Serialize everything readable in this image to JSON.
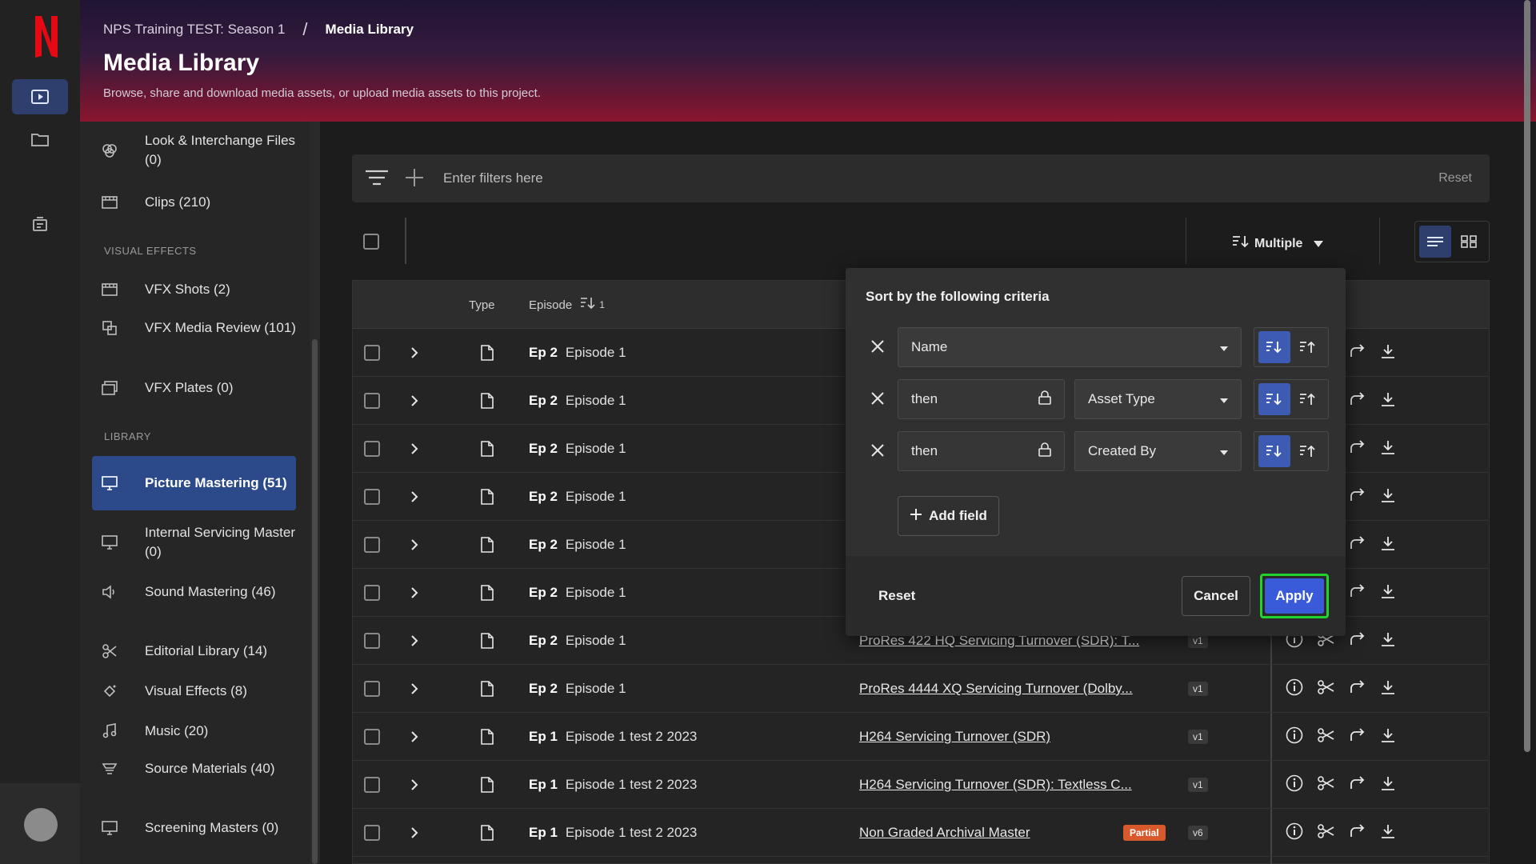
{
  "breadcrumb": {
    "project": "NPS Training TEST: Season 1",
    "separator": "/",
    "current": "Media Library"
  },
  "page": {
    "title": "Media Library",
    "subtitle": "Browse, share and download media assets, or upload media assets to this project."
  },
  "sidebar": {
    "items_top": [
      {
        "label": "Look & Interchange Files (0)",
        "icon": "circles-icon"
      },
      {
        "label": "Clips (210)",
        "icon": "film-icon"
      }
    ],
    "section_vfx": "VISUAL EFFECTS",
    "items_vfx": [
      {
        "label": "VFX Shots (2)",
        "icon": "film-icon"
      },
      {
        "label": "VFX Media Review (101)",
        "icon": "review-icon"
      },
      {
        "label": "VFX Plates (0)",
        "icon": "plates-icon"
      }
    ],
    "section_library": "LIBRARY",
    "items_library": [
      {
        "label": "Picture Mastering (51)",
        "icon": "monitor-icon",
        "active": true
      },
      {
        "label": "Internal Servicing Master (0)",
        "icon": "monitor-icon"
      },
      {
        "label": "Sound Mastering (46)",
        "icon": "speaker-icon"
      },
      {
        "label": "Editorial Library (14)",
        "icon": "scissors-icon"
      },
      {
        "label": "Visual Effects (8)",
        "icon": "sparkle-icon"
      },
      {
        "label": "Music (20)",
        "icon": "music-icon"
      },
      {
        "label": "Source Materials (40)",
        "icon": "source-icon"
      },
      {
        "label": "Screening Masters (0)",
        "icon": "monitor-icon"
      }
    ]
  },
  "filter": {
    "placeholder": "Enter filters here",
    "reset": "Reset"
  },
  "toolbar": {
    "sort_label": "Multiple"
  },
  "table": {
    "headers": {
      "type": "Type",
      "episode": "Episode",
      "episode_sort_rank": "1"
    },
    "rows": [
      {
        "ep": "Ep 2",
        "name": "Episode 1",
        "asset": "",
        "version": "",
        "partial": ""
      },
      {
        "ep": "Ep 2",
        "name": "Episode 1",
        "asset": "",
        "version": "",
        "partial": ""
      },
      {
        "ep": "Ep 2",
        "name": "Episode 1",
        "asset": "",
        "version": "",
        "partial": ""
      },
      {
        "ep": "Ep 2",
        "name": "Episode 1",
        "asset": "",
        "version": "",
        "partial": ""
      },
      {
        "ep": "Ep 2",
        "name": "Episode 1",
        "asset": "",
        "version": "",
        "partial": ""
      },
      {
        "ep": "Ep 2",
        "name": "Episode 1",
        "asset": "",
        "version": "",
        "partial": ""
      },
      {
        "ep": "Ep 2",
        "name": "Episode 1",
        "asset": "ProRes 422 HQ Servicing Turnover (SDR): T...",
        "version": "v1",
        "partial": ""
      },
      {
        "ep": "Ep 2",
        "name": "Episode 1",
        "asset": "ProRes 4444 XQ Servicing Turnover (Dolby...",
        "version": "v1",
        "partial": ""
      },
      {
        "ep": "Ep 1",
        "name": "Episode 1 test 2 2023",
        "asset": "H264 Servicing Turnover (SDR)",
        "version": "v1",
        "partial": ""
      },
      {
        "ep": "Ep 1",
        "name": "Episode 1 test 2 2023",
        "asset": "H264 Servicing Turnover (SDR): Textless C...",
        "version": "v1",
        "partial": ""
      },
      {
        "ep": "Ep 1",
        "name": "Episode 1 test 2 2023",
        "asset": "Non Graded Archival Master",
        "version": "v6",
        "partial": "Partial"
      }
    ]
  },
  "sort_popover": {
    "title": "Sort by the following criteria",
    "criteria": [
      {
        "prefix": "",
        "field": "Name"
      },
      {
        "prefix": "then",
        "field": "Asset Type"
      },
      {
        "prefix": "then",
        "field": "Created By"
      }
    ],
    "add_field": "Add field",
    "reset": "Reset",
    "cancel": "Cancel",
    "apply": "Apply"
  },
  "colors": {
    "accent": "#3a5bd9",
    "active_nav": "#2c4a8a",
    "partial": "#d85a2c",
    "apply_focus": "#22d22e"
  }
}
